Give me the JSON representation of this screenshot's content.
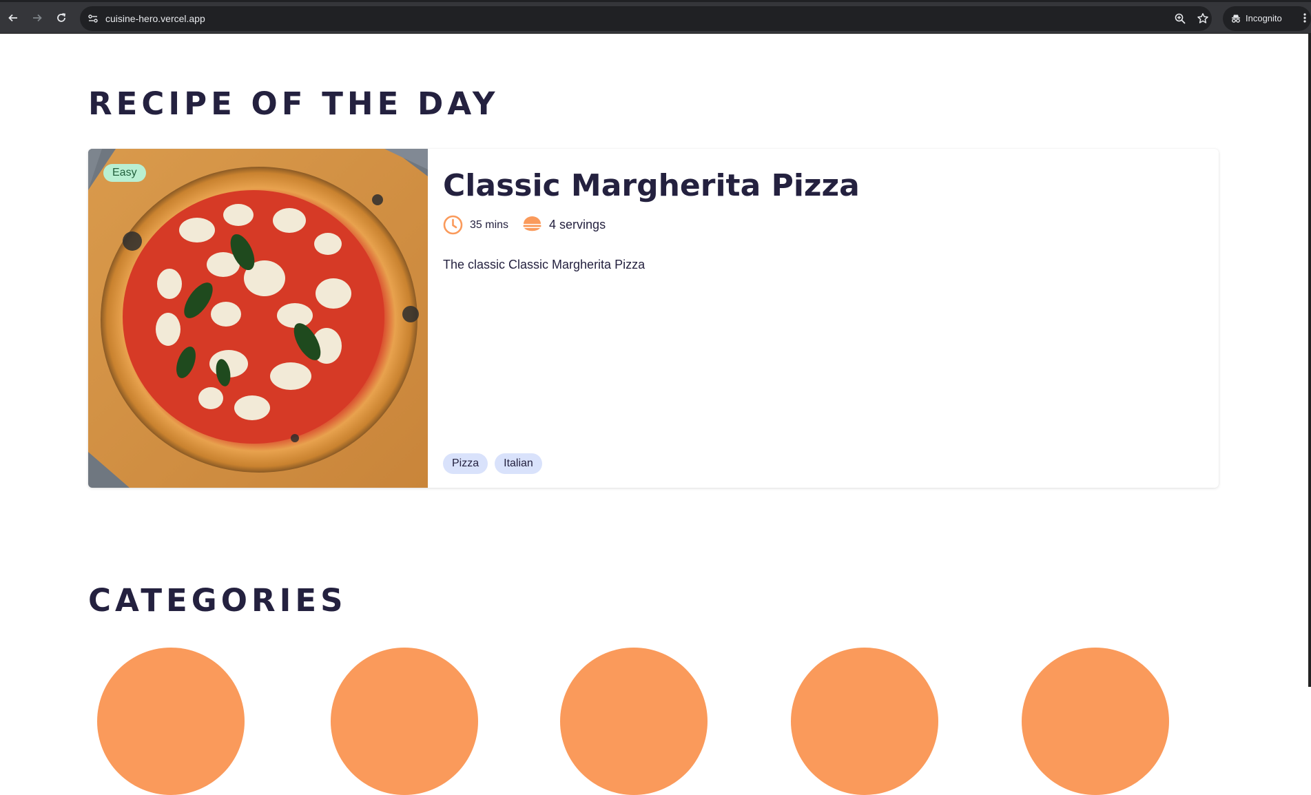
{
  "browser": {
    "url": "cuisine-hero.vercel.app",
    "incognito_label": "Incognito",
    "icons": [
      "back-icon",
      "forward-icon",
      "reload-icon",
      "site-info-icon",
      "zoom-icon",
      "bookmark-star-icon",
      "incognito-icon",
      "menu-icon"
    ]
  },
  "recipe_section": {
    "title": "RECIPE OF THE DAY",
    "recipe": {
      "difficulty": "Easy",
      "title": "Classic Margherita Pizza",
      "time": "35 mins",
      "servings": "4 servings",
      "description": "The classic Classic Margherita Pizza",
      "tags": [
        "Pizza",
        "Italian"
      ]
    }
  },
  "categories_section": {
    "title": "CATEGORIES"
  },
  "colors": {
    "accent": "#fa9a5b",
    "heading": "#24213f",
    "easy_badge_bg": "#b9efd2",
    "tag_bg": "#d9e2fb"
  }
}
